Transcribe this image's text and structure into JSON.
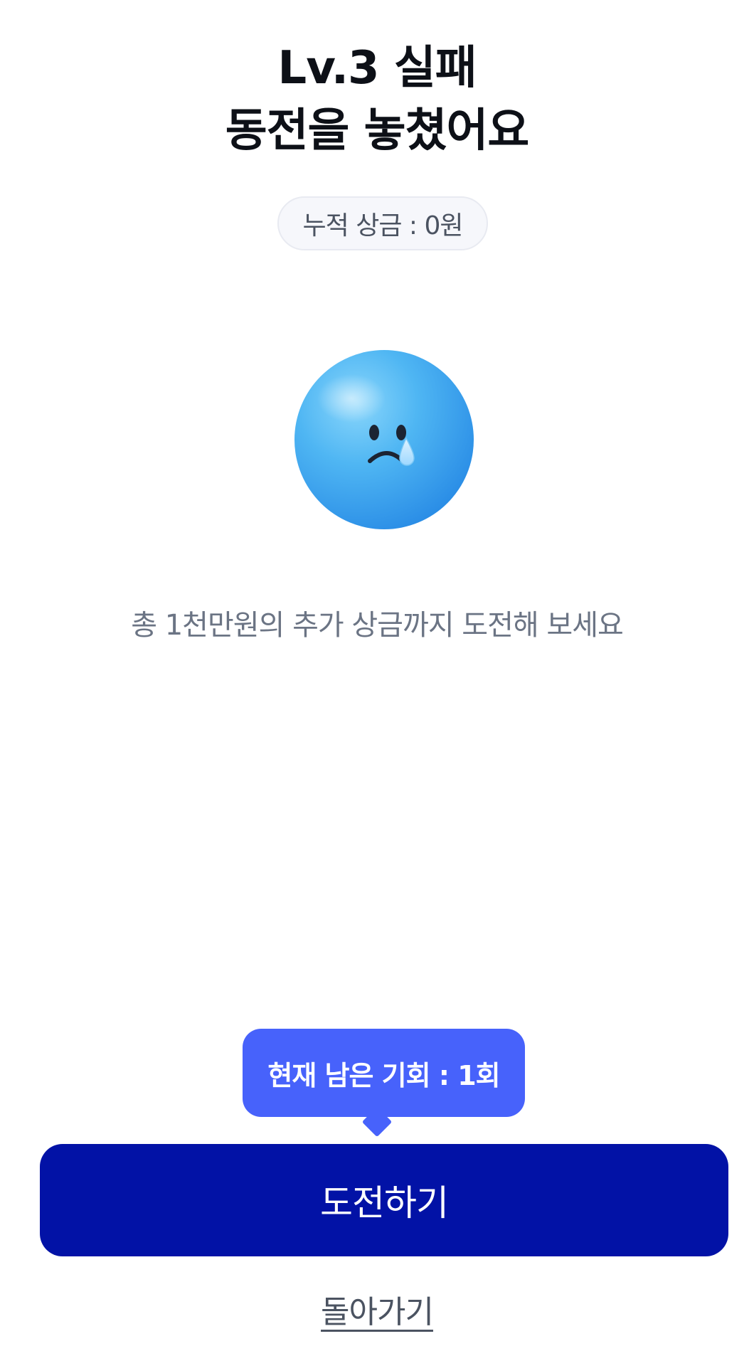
{
  "header": {
    "title_line1": "Lv.3 실패",
    "title_line2": "동전을 놓쳤어요"
  },
  "prize": {
    "label": "누적 상금 : 0원"
  },
  "emoji": {
    "icon": "crying-face-icon"
  },
  "message": {
    "text": "총 1천만원의 추가 상금까지 도전해 보세요"
  },
  "tooltip": {
    "text": "현재 남은 기회 : 1회"
  },
  "actions": {
    "challenge_label": "도전하기",
    "back_label": "돌아가기"
  },
  "colors": {
    "primary_button": "#0212a6",
    "tooltip": "#4762fb",
    "title": "#0d1017",
    "subtitle": "#6b7484"
  }
}
